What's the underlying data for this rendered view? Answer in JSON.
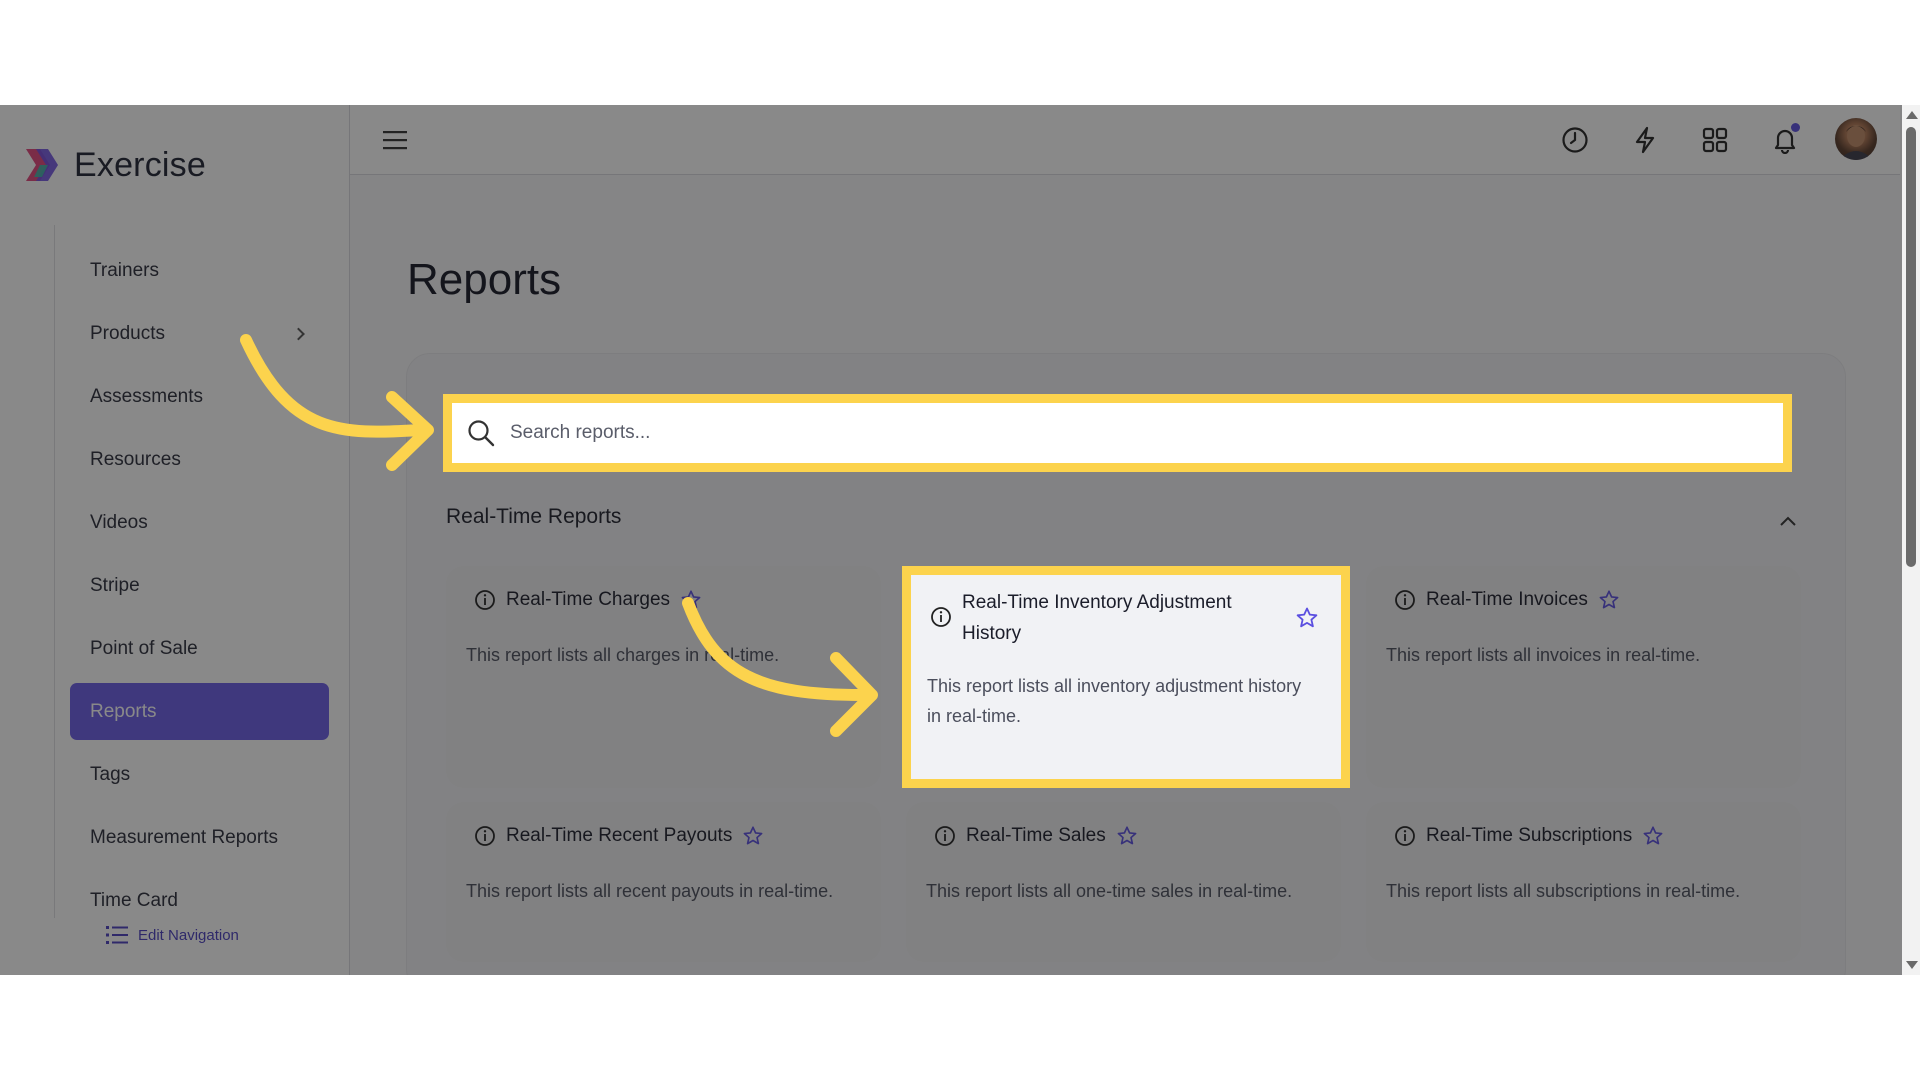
{
  "app": {
    "brand": "Exercise"
  },
  "sidebar": {
    "items": [
      {
        "label": "Trainers"
      },
      {
        "label": "Products"
      },
      {
        "label": "Assessments"
      },
      {
        "label": "Resources"
      },
      {
        "label": "Videos"
      },
      {
        "label": "Stripe"
      },
      {
        "label": "Point of Sale"
      },
      {
        "label": "Reports",
        "active": true
      },
      {
        "label": "Tags"
      },
      {
        "label": "Measurement Reports"
      },
      {
        "label": "Time Card"
      }
    ],
    "edit_nav": "Edit Navigation"
  },
  "topbar": {
    "icons": [
      "menu-icon",
      "clock-icon",
      "lightning-icon",
      "grid-icon",
      "bell-icon",
      "avatar"
    ]
  },
  "main": {
    "title": "Reports",
    "search": {
      "placeholder": "Search reports...",
      "value": ""
    },
    "section": {
      "title": "Real-Time Reports"
    },
    "cards": [
      {
        "title": "Real-Time Charges",
        "desc": "This report lists all charges in real-time."
      },
      {
        "title": "Real-Time Inventory Adjustment History",
        "title_line1": "Real-Time Inventory Adjustment",
        "title_line2": "History",
        "desc": "This report lists all inventory adjustment history in real-time.",
        "desc_line1": "This report lists all inventory adjustment history",
        "desc_line2": "in real-time."
      },
      {
        "title": "Real-Time Invoices",
        "desc": "This report lists all invoices in real-time."
      },
      {
        "title": "Real-Time Recent Payouts",
        "desc": "This report lists all recent payouts in real-time."
      },
      {
        "title": "Real-Time Sales",
        "desc": "This report lists all one-time sales in real-time."
      },
      {
        "title": "Real-Time Subscriptions",
        "desc": "This report lists all subscriptions in real-time."
      }
    ]
  },
  "colors": {
    "accent": "#6b5ce7",
    "highlight": "#fcd34d",
    "star": "#5b4fe0"
  }
}
